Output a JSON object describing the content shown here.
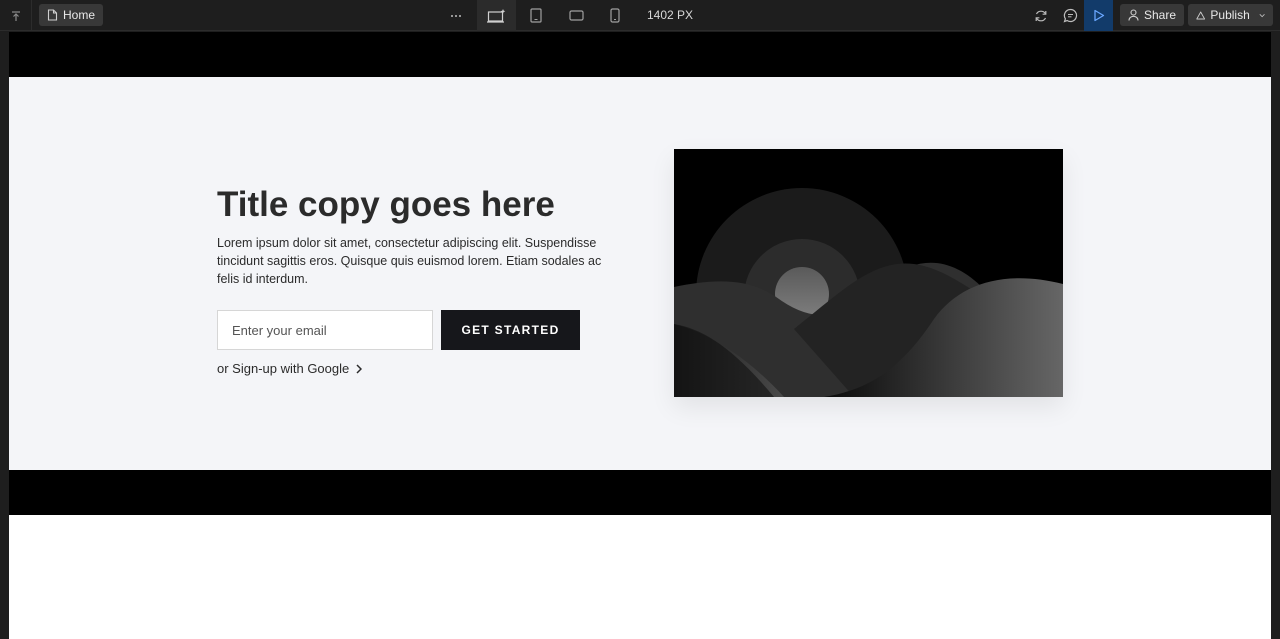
{
  "toolbar": {
    "page_name": "Home",
    "viewport_width": "1402 PX",
    "share_label": "Share",
    "publish_label": "Publish",
    "accent": "#123b6a"
  },
  "hero": {
    "title": "Title copy goes here",
    "description": "Lorem ipsum dolor sit amet, consectetur adipiscing elit. Suspendisse tincidunt sagittis eros. Quisque quis euismod lorem. Etiam sodales ac felis id interdum.",
    "email_placeholder": "Enter your email",
    "cta_label": "GET STARTED",
    "google_link_label": "or Sign-up with Google",
    "image_icon": "landscape-placeholder-image"
  },
  "colors": {
    "toolbar_bg": "#1e1e1e",
    "hero_bg": "#f4f5f8",
    "cta_bg": "#16171b"
  }
}
